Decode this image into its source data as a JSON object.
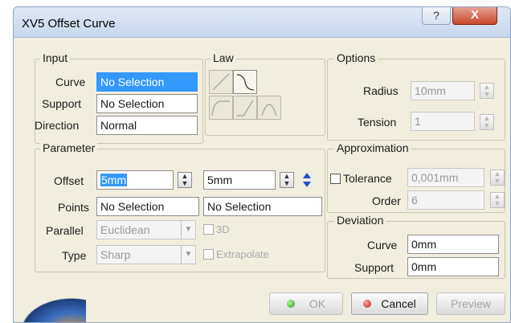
{
  "window": {
    "title": "XV5 Offset Curve",
    "help_label": "?",
    "close_label": "X"
  },
  "input": {
    "legend": "Input",
    "curve_label": "Curve",
    "curve_value": "No Selection",
    "support_label": "Support",
    "support_value": "No Selection",
    "direction_label": "Direction",
    "direction_value": "Normal"
  },
  "law": {
    "legend": "Law",
    "buttons": [
      "linear-law-icon",
      "s-curve-law-icon",
      "step-up-law-icon",
      "ramp-law-icon",
      "bump-law-icon"
    ]
  },
  "options": {
    "legend": "Options",
    "radius_label": "Radius",
    "radius_value": "10mm",
    "tension_label": "Tension",
    "tension_value": "1"
  },
  "parameter": {
    "legend": "Parameter",
    "offset_label": "Offset",
    "offset_value_1": "5mm",
    "offset_value_2": "5mm",
    "points_label": "Points",
    "points_value_1": "No Selection",
    "points_value_2": "No Selection",
    "parallel_label": "Parallel",
    "parallel_value": "Euclidean",
    "option_3d_label": "3D",
    "type_label": "Type",
    "type_value": "Sharp",
    "extrapolate_label": "Extrapolate"
  },
  "approximation": {
    "legend": "Approximation",
    "tolerance_label": "Tolerance",
    "tolerance_value": "0,001mm",
    "order_label": "Order",
    "order_value": "6"
  },
  "deviation": {
    "legend": "Deviation",
    "curve_label": "Curve",
    "curve_value": "0mm",
    "support_label": "Support",
    "support_value": "0mm"
  },
  "buttons": {
    "ok_label": "OK",
    "cancel_label": "Cancel",
    "preview_label": "Preview"
  },
  "colors": {
    "selection": "#3399ff",
    "ok_dot": "#2f9a1a",
    "cancel_dot": "#c41a1a",
    "swap_arrows": "#1e4fd6"
  }
}
